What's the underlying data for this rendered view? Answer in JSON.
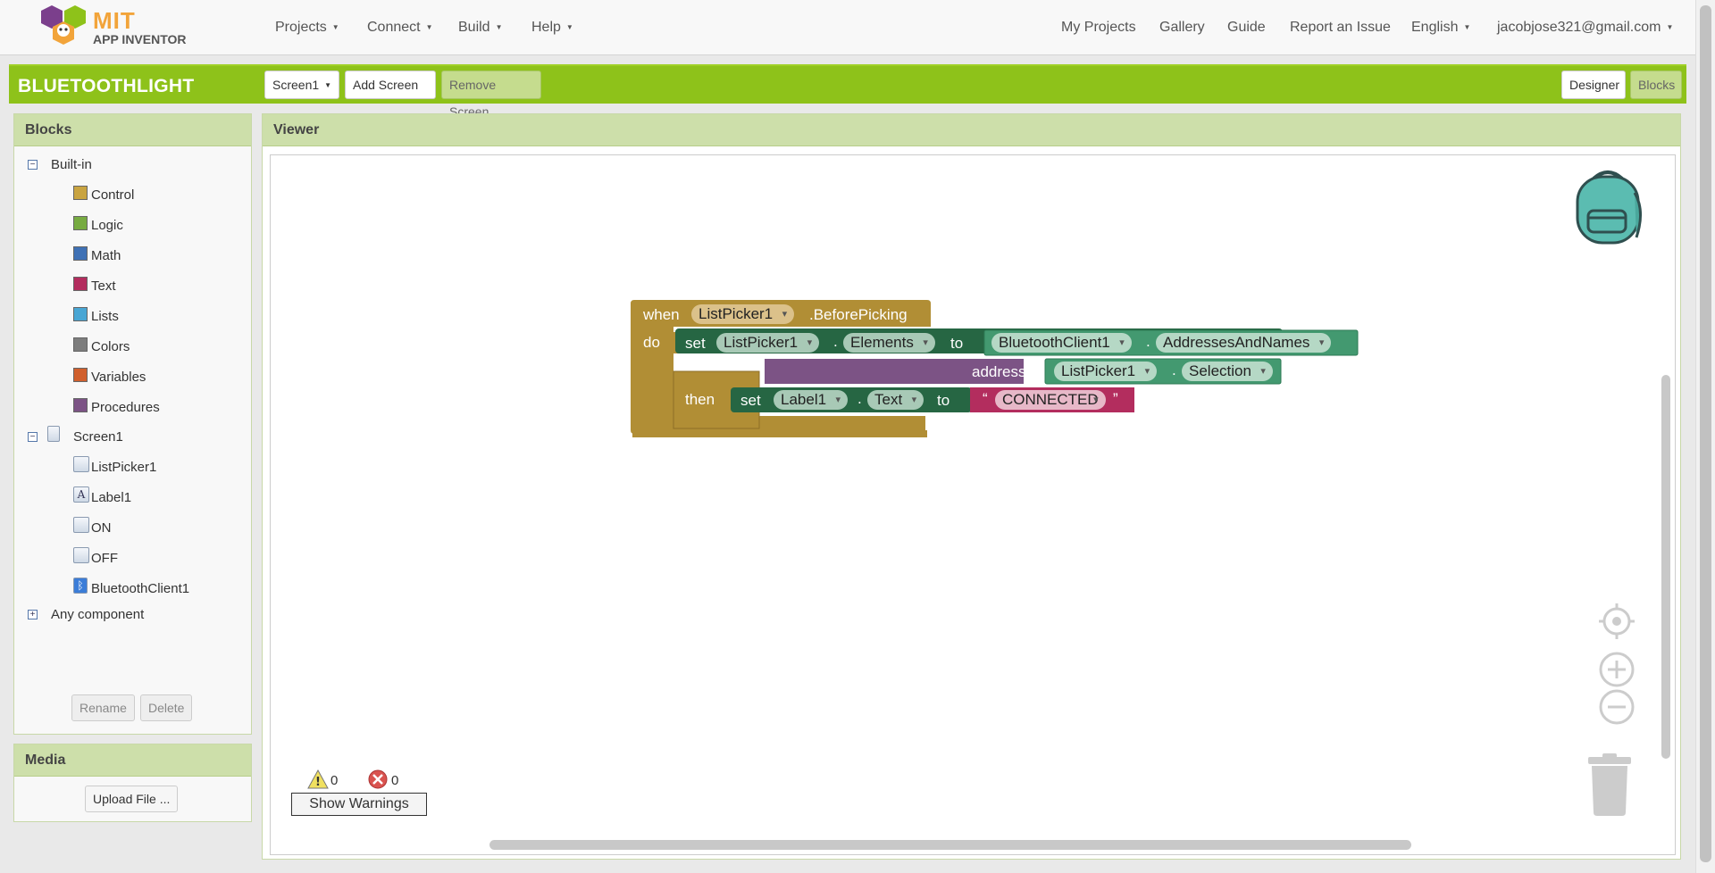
{
  "app": {
    "logo_text": "MIT",
    "logo_subtext": "APP INVENTOR"
  },
  "nav": {
    "menus": [
      "Projects",
      "Connect",
      "Build",
      "Help"
    ],
    "links": [
      "My Projects",
      "Gallery",
      "Guide",
      "Report an Issue"
    ],
    "language": "English",
    "account": "jacobjose321@gmail.com"
  },
  "project": {
    "name": "BLUETOOTHLIGHT",
    "screen_select": "Screen1",
    "add_screen": "Add Screen ...",
    "remove_screen": "Remove Screen",
    "designer": "Designer",
    "blocks": "Blocks"
  },
  "blocks_panel": {
    "title": "Blocks",
    "builtin_label": "Built-in",
    "builtin_items": [
      {
        "label": "Control",
        "color": "#c9a441"
      },
      {
        "label": "Logic",
        "color": "#77ab41"
      },
      {
        "label": "Math",
        "color": "#3f71b5"
      },
      {
        "label": "Text",
        "color": "#b32d5e"
      },
      {
        "label": "Lists",
        "color": "#49a6d4"
      },
      {
        "label": "Colors",
        "color": "#7d7d7d"
      },
      {
        "label": "Variables",
        "color": "#d05f2d"
      },
      {
        "label": "Procedures",
        "color": "#7c5385"
      }
    ],
    "screen_label": "Screen1",
    "components": [
      "ListPicker1",
      "Label1",
      "ON",
      "OFF",
      "BluetoothClient1"
    ],
    "any_component": "Any component",
    "rename": "Rename",
    "delete": "Delete"
  },
  "media_panel": {
    "title": "Media",
    "upload": "Upload File ..."
  },
  "viewer": {
    "title": "Viewer",
    "warnings_count": "0",
    "errors_count": "0",
    "show_warnings": "Show Warnings"
  },
  "code_blocks": {
    "when": "when",
    "event_component": "ListPicker1",
    "event_name": ".BeforePicking",
    "do": "do",
    "set1": "set",
    "set1_component": "ListPicker1",
    "dot1": ".",
    "set1_property": "Elements",
    "to1": "to",
    "get_component": "BluetoothClient1",
    "dot2": ".",
    "get_property": "AddressesAndNames",
    "address": "address",
    "addr_component": "ListPicker1",
    "dot3": ".",
    "addr_property": "Selection",
    "then": "then",
    "set2": "set",
    "set2_component": "Label1",
    "dot4": ".",
    "set2_property": "Text",
    "to2": "to",
    "quote_open": "“",
    "string_value": "CONNECTED",
    "quote_close": "”"
  },
  "colors": {
    "accent": "#8ec21a",
    "panel_header": "#cddfaa",
    "control_block": "#b18e35",
    "setter_block": "#266643",
    "getter_block": "#439970",
    "method_block": "#7c5385",
    "text_block": "#b32d5e"
  }
}
